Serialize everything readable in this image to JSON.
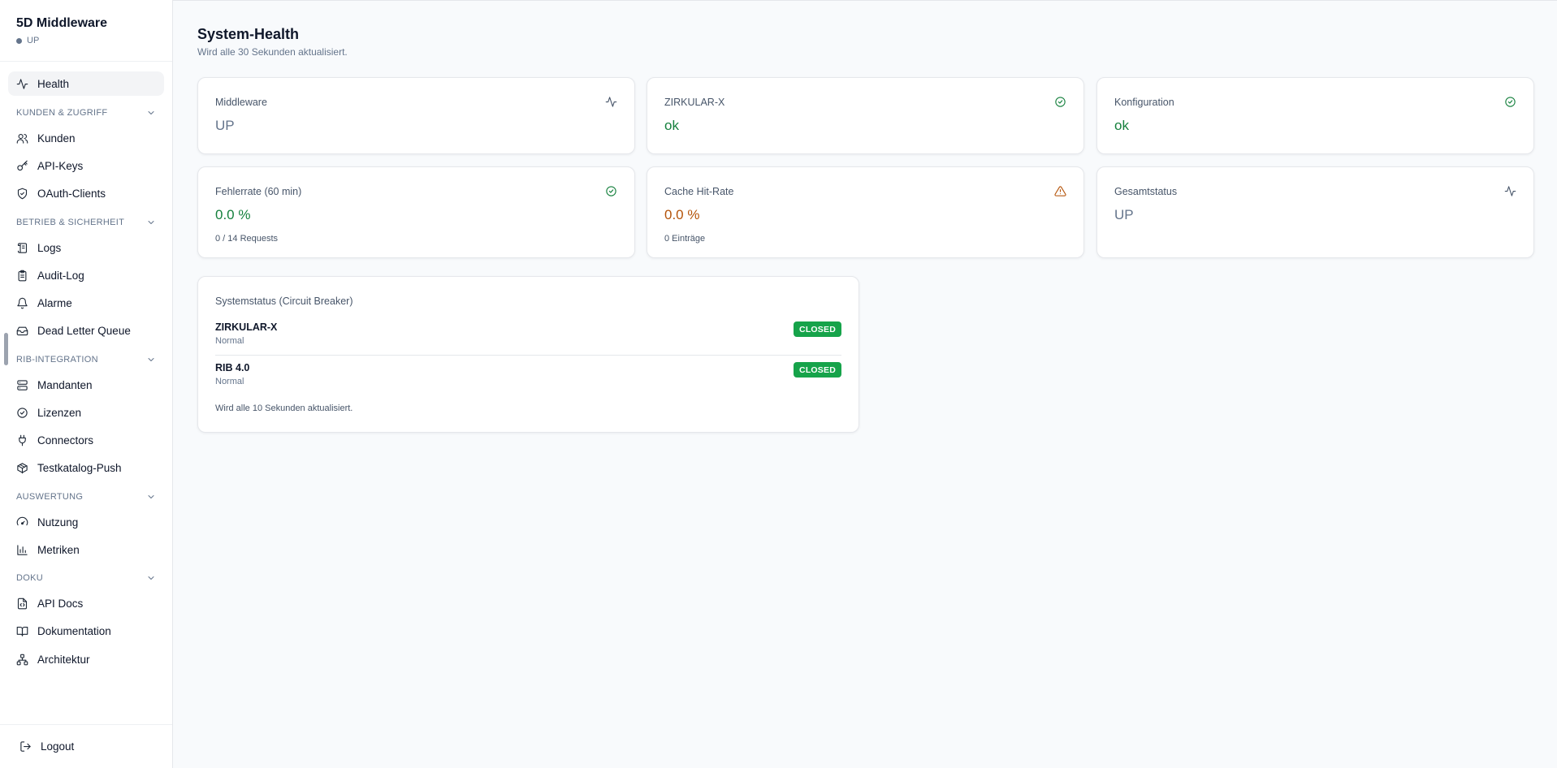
{
  "app": {
    "title": "5D Middleware",
    "status": "UP"
  },
  "sidebar": {
    "health": "Health",
    "sections": {
      "kunden": "KUNDEN & ZUGRIFF",
      "betrieb": "BETRIEB & SICHERHEIT",
      "rib": "RIB-INTEGRATION",
      "auswertung": "AUSWERTUNG",
      "doku": "DOKU"
    },
    "items": {
      "kunden": "Kunden",
      "apikeys": "API-Keys",
      "oauth": "OAuth-Clients",
      "logs": "Logs",
      "auditlog": "Audit-Log",
      "alarme": "Alarme",
      "dlq": "Dead Letter Queue",
      "mandanten": "Mandanten",
      "lizenzen": "Lizenzen",
      "connectors": "Connectors",
      "testkatalog": "Testkatalog-Push",
      "nutzung": "Nutzung",
      "metriken": "Metriken",
      "apidocs": "API Docs",
      "dokumentation": "Dokumentation",
      "architektur": "Architektur"
    },
    "logout": "Logout"
  },
  "page": {
    "title": "System-Health",
    "subtitle": "Wird alle 30 Sekunden aktualisiert."
  },
  "cards": {
    "middleware": {
      "label": "Middleware",
      "value": "UP",
      "icon": "activity-icon"
    },
    "zirkular": {
      "label": "ZIRKULAR-X",
      "value": "ok",
      "icon": "check-circle-icon"
    },
    "konfiguration": {
      "label": "Konfiguration",
      "value": "ok",
      "icon": "check-circle-icon"
    },
    "fehlerrate": {
      "label": "Fehlerrate (60 min)",
      "value": "0.0 %",
      "meta": "0 / 14 Requests",
      "icon": "check-circle-icon"
    },
    "cache": {
      "label": "Cache Hit-Rate",
      "value": "0.0 %",
      "meta": "0 Einträge",
      "icon": "warning-triangle-icon"
    },
    "gesamtstatus": {
      "label": "Gesamtstatus",
      "value": "UP",
      "icon": "activity-icon"
    }
  },
  "circuit": {
    "title": "Systemstatus (Circuit Breaker)",
    "rows": [
      {
        "name": "ZIRKULAR-X",
        "state": "Normal",
        "badge": "CLOSED"
      },
      {
        "name": "RIB 4.0",
        "state": "Normal",
        "badge": "CLOSED"
      }
    ],
    "footer": "Wird alle 10 Sekunden aktualisiert."
  },
  "colors": {
    "ok": "#15803d",
    "warn": "#b45309",
    "neutral": "#64748b",
    "badge": "#16a34a"
  }
}
